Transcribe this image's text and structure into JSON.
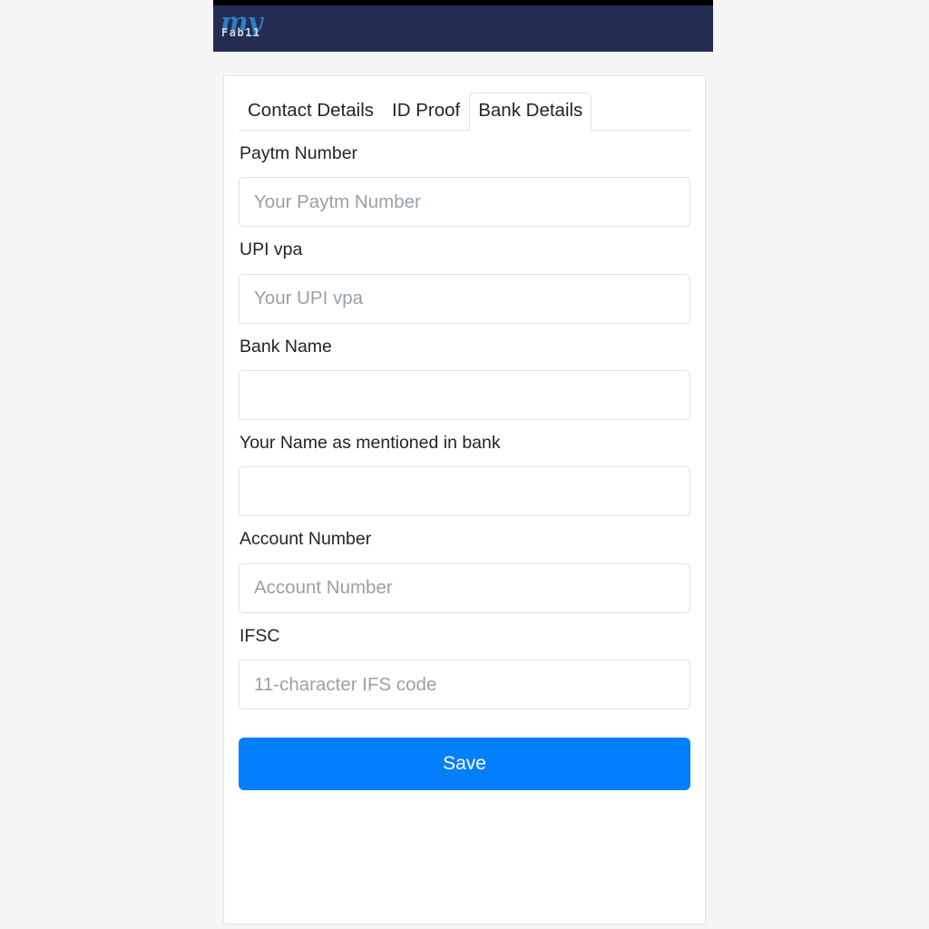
{
  "header": {
    "logo_primary": "my",
    "logo_secondary": "Fab11",
    "brand_color": "#2f7ec0",
    "background_color": "#252c54"
  },
  "tabs": [
    {
      "label": "Contact Details",
      "active": false
    },
    {
      "label": "ID Proof",
      "active": false
    },
    {
      "label": "Bank Details",
      "active": true
    }
  ],
  "form": {
    "fields": [
      {
        "label": "Paytm Number",
        "value": "",
        "placeholder": "Your Paytm Number"
      },
      {
        "label": "UPI vpa",
        "value": "",
        "placeholder": "Your UPI vpa"
      },
      {
        "label": "Bank Name",
        "value": "",
        "placeholder": ""
      },
      {
        "label": "Your Name as mentioned in bank",
        "value": "",
        "placeholder": ""
      },
      {
        "label": "Account Number",
        "value": "",
        "placeholder": "Account Number"
      },
      {
        "label": "IFSC",
        "value": "",
        "placeholder": "11-character IFS code"
      }
    ],
    "save_label": "Save",
    "save_color": "#047ffe"
  }
}
